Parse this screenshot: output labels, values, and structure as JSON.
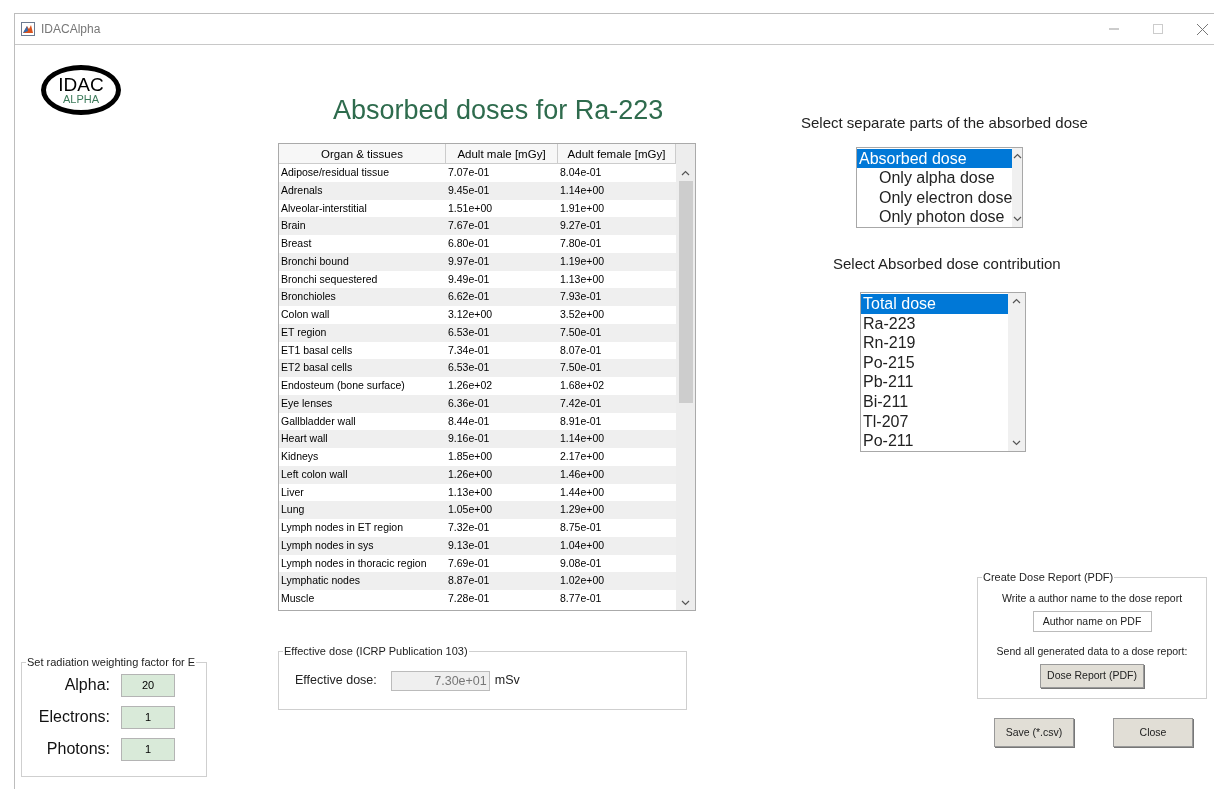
{
  "window": {
    "title": "IDACAlpha"
  },
  "logo": {
    "top": "IDAC",
    "bottom": "ALPHA"
  },
  "heading": "Absorbed doses for Ra-223",
  "table": {
    "columns": [
      "Organ & tissues",
      "Adult male [mGy]",
      "Adult female [mGy]"
    ],
    "rows": [
      [
        "Adipose/residual tissue",
        "7.07e-01",
        "8.04e-01"
      ],
      [
        "Adrenals",
        "9.45e-01",
        "1.14e+00"
      ],
      [
        "Alveolar-interstitial",
        "1.51e+00",
        "1.91e+00"
      ],
      [
        "Brain",
        "7.67e-01",
        "9.27e-01"
      ],
      [
        "Breast",
        "6.80e-01",
        "7.80e-01"
      ],
      [
        "Bronchi bound",
        "9.97e-01",
        "1.19e+00"
      ],
      [
        "Bronchi sequestered",
        "9.49e-01",
        "1.13e+00"
      ],
      [
        "Bronchioles",
        "6.62e-01",
        "7.93e-01"
      ],
      [
        "Colon wall",
        "3.12e+00",
        "3.52e+00"
      ],
      [
        "ET region",
        "6.53e-01",
        "7.50e-01"
      ],
      [
        "ET1 basal cells",
        "7.34e-01",
        "8.07e-01"
      ],
      [
        "ET2 basal cells",
        "6.53e-01",
        "7.50e-01"
      ],
      [
        "Endosteum (bone surface)",
        "1.26e+02",
        "1.68e+02"
      ],
      [
        "Eye lenses",
        "6.36e-01",
        "7.42e-01"
      ],
      [
        "Gallbladder wall",
        "8.44e-01",
        "8.91e-01"
      ],
      [
        "Heart wall",
        "9.16e-01",
        "1.14e+00"
      ],
      [
        "Kidneys",
        "1.85e+00",
        "2.17e+00"
      ],
      [
        "Left colon wall",
        "1.26e+00",
        "1.46e+00"
      ],
      [
        "Liver",
        "1.13e+00",
        "1.44e+00"
      ],
      [
        "Lung",
        "1.05e+00",
        "1.29e+00"
      ],
      [
        "Lymph nodes in ET region",
        "7.32e-01",
        "8.75e-01"
      ],
      [
        "Lymph nodes in sys",
        "9.13e-01",
        "1.04e+00"
      ],
      [
        "Lymph nodes in thoracic region",
        "7.69e-01",
        "9.08e-01"
      ],
      [
        "Lymphatic nodes",
        "8.87e-01",
        "1.02e+00"
      ],
      [
        "Muscle",
        "7.28e-01",
        "8.77e-01"
      ]
    ]
  },
  "effective_dose": {
    "title": "Effective dose (ICRP Publication 103)",
    "label": "Effective dose:",
    "value": "7.30e+01",
    "unit": "mSv",
    "disabled": true
  },
  "weighting": {
    "title": "Set radiation weighting factor for E",
    "fields": [
      {
        "label": "Alpha:",
        "value": "20"
      },
      {
        "label": "Electrons:",
        "value": "1"
      },
      {
        "label": "Photons:",
        "value": "1"
      }
    ]
  },
  "parts": {
    "label": "Select separate parts of the absorbed dose",
    "items": [
      {
        "label": "Absorbed dose",
        "selected": true,
        "children": [
          {
            "label": "Only alpha dose",
            "selected": false
          },
          {
            "label": "Only electron dose",
            "selected": false
          },
          {
            "label": "Only photon dose",
            "selected": false
          }
        ]
      }
    ]
  },
  "contribution": {
    "label": "Select Absorbed dose contribution",
    "items": [
      {
        "label": "Total dose",
        "selected": true
      },
      {
        "label": "Ra-223",
        "selected": false
      },
      {
        "label": "Rn-219",
        "selected": false
      },
      {
        "label": "Po-215",
        "selected": false
      },
      {
        "label": "Pb-211",
        "selected": false
      },
      {
        "label": "Bi-211",
        "selected": false
      },
      {
        "label": "Tl-207",
        "selected": false
      },
      {
        "label": "Po-211",
        "selected": false
      }
    ]
  },
  "report": {
    "title": "Create Dose Report (PDF)",
    "author_prompt": "Write a author name to the dose report",
    "author_value": "Author name on PDF",
    "send_prompt": "Send all generated data to a dose report:",
    "button": "Dose Report (PDF)"
  },
  "buttons": [
    "Save (*.csv)",
    "Close"
  ]
}
